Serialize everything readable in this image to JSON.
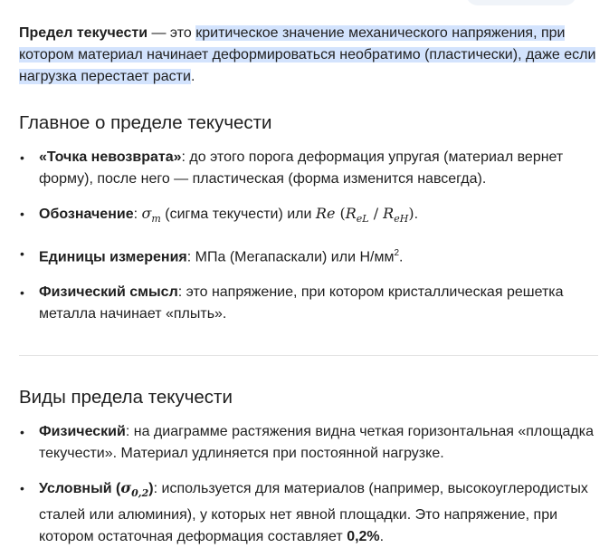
{
  "intro": {
    "term": "Предел текучести",
    "dash": " — это ",
    "definition": "критическое значение механического напряжения, при котором материал начинает деформироваться необратимо (пластически), даже если нагрузка перестает расти",
    "end": "."
  },
  "section1": {
    "heading": "Главное о пределе текучести",
    "items": [
      {
        "bold": "«Точка невозврата»",
        "text": ": до этого порога деформация упругая (материал вернет форму), после него — пластическая (форма изменится навсегда)."
      },
      {
        "bold": "Обозначение",
        "text_before": ": ",
        "sigma": "σ",
        "sigma_sub": "т",
        "text_mid": " (сигма текучести) или ",
        "re": "Re",
        "paren_open": " (",
        "rel": "R",
        "rel_sub": "eL",
        "slash": " / ",
        "reh": "R",
        "reh_sub": "eH",
        "paren_close": ")",
        "text_end": "."
      },
      {
        "bold": "Единицы измерения",
        "text": ": МПа (Мегапаскали) или Н/мм",
        "sup": "2",
        "end": "."
      },
      {
        "bold": "Физический смысл",
        "text": ": это напряжение, при котором кристаллическая решетка металла начинает «плыть»."
      }
    ]
  },
  "section2": {
    "heading": "Виды предела текучести",
    "items": [
      {
        "bold": "Физический",
        "text": ": на диаграмме растяжения видна четкая горизонтальная «площадка текучести». Материал удлиняется при постоянной нагрузке."
      },
      {
        "bold_prefix": "Условный (",
        "sigma": "σ",
        "sigma_sub": "0,2",
        "bold_suffix": ")",
        "text": ": используется для материалов (например, высокоуглеродистых сталей или алюминия), у которых нет явной площадки. Это напряжение, при котором остаточная деформация составляет ",
        "value": "0,2%",
        "end": "."
      }
    ]
  },
  "bullet": "•"
}
